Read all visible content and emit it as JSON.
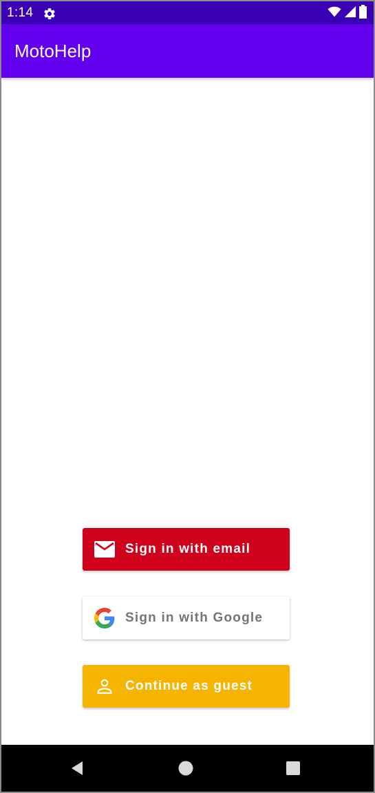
{
  "status_bar": {
    "time": "1:14",
    "icons": [
      "settings-gear-icon",
      "wifi-icon",
      "cellular-signal-icon",
      "battery-icon"
    ],
    "background": "#3a00b4"
  },
  "app_bar": {
    "title": "MotoHelp",
    "background": "#6200ee"
  },
  "auth": {
    "email_button": {
      "label": "Sign in with email",
      "icon": "email-envelope-icon",
      "background": "#d0021b"
    },
    "google_button": {
      "label": "Sign in with Google",
      "icon": "google-g-logo-icon",
      "background": "#ffffff"
    },
    "guest_button": {
      "label": "Continue as guest",
      "icon": "person-icon",
      "background": "#f4b400"
    }
  },
  "nav_bar": {
    "buttons": [
      "back-icon",
      "home-icon",
      "recents-icon"
    ],
    "background": "#000000"
  }
}
